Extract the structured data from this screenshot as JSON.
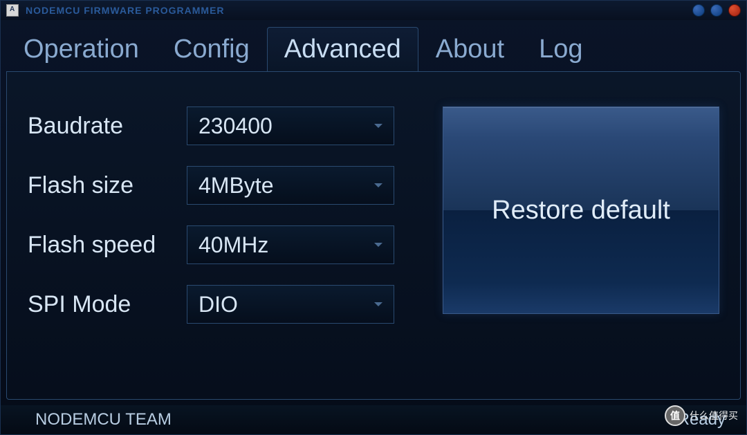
{
  "window": {
    "title": "NODEMCU FIRMWARE PROGRAMMER"
  },
  "tabs": {
    "operation": "Operation",
    "config": "Config",
    "advanced": "Advanced",
    "about": "About",
    "log": "Log",
    "active": "advanced"
  },
  "settings": {
    "baudrate": {
      "label": "Baudrate",
      "value": "230400"
    },
    "flash_size": {
      "label": "Flash size",
      "value": "4MByte"
    },
    "flash_speed": {
      "label": "Flash speed",
      "value": "40MHz"
    },
    "spi_mode": {
      "label": "SPI Mode",
      "value": "DIO"
    }
  },
  "buttons": {
    "restore_default": "Restore default"
  },
  "statusbar": {
    "left": "NODEMCU TEAM",
    "right": "Ready"
  },
  "watermark": {
    "badge": "值",
    "text": "什么值得买"
  }
}
